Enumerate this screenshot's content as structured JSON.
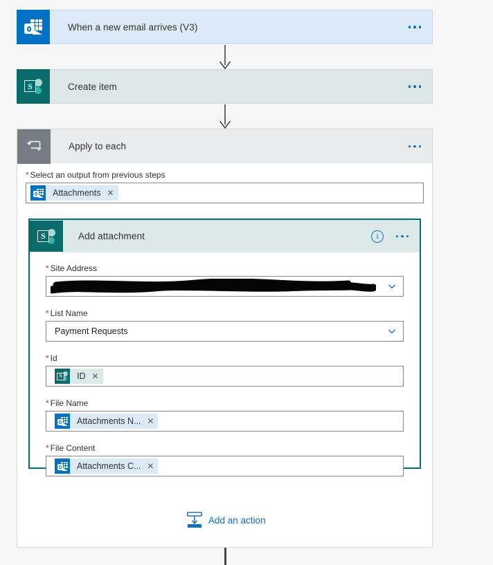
{
  "page": {
    "background_color": "#f6f6f6",
    "app": "Power Automate flow designer"
  },
  "flow": {
    "trigger": {
      "title": "When a new email arrives (V3)",
      "icon": "outlook-icon",
      "header_color": "#dceaf7",
      "menu_label": "..."
    },
    "create_item": {
      "title": "Create item",
      "icon": "sharepoint-icon",
      "header_color": "#dde7e7",
      "menu_label": "..."
    },
    "apply_to_each": {
      "title": "Apply to each",
      "icon": "loop-icon",
      "header_color": "#eaebed",
      "menu_label": "...",
      "select_output": {
        "label": "Select an output from previous steps",
        "required_marker": "*",
        "token": {
          "text": "Attachments",
          "icon": "outlook-icon",
          "remove_label": "✕"
        }
      }
    },
    "add_attachment": {
      "title": "Add attachment",
      "icon": "sharepoint-icon",
      "header_color": "#dde9e9",
      "border_color": "#036c70",
      "info_label": "i",
      "menu_label": "...",
      "fields": [
        {
          "label": "Site Address",
          "required_marker": "*",
          "type": "combo",
          "value": "",
          "redacted": true,
          "chevron": "chevron-down-icon"
        },
        {
          "label": "List Name",
          "required_marker": "*",
          "type": "combo",
          "value": "Payment Requests",
          "redacted": false,
          "chevron": "chevron-down-icon"
        },
        {
          "label": "Id",
          "required_marker": "*",
          "type": "token",
          "token": {
            "text": "ID",
            "icon": "sharepoint-icon",
            "remove_label": "✕"
          }
        },
        {
          "label": "File Name",
          "required_marker": "*",
          "type": "token",
          "token": {
            "text": "Attachments N...",
            "icon": "outlook-icon",
            "remove_label": "✕"
          }
        },
        {
          "label": "File Content",
          "required_marker": "*",
          "type": "token",
          "token": {
            "text": "Attachments C...",
            "icon": "outlook-icon",
            "remove_label": "✕"
          }
        }
      ]
    },
    "add_action": {
      "label": "Add an action",
      "icon": "insert-action-icon",
      "color": "#0b6cbf"
    }
  },
  "icons": {
    "sharepoint_letter": "S"
  },
  "colors": {
    "outlook_blue": "#0072c6",
    "sharepoint_teal": "#0b6a6a",
    "loop_gray": "#767b84",
    "link_blue": "#0b6cbf",
    "required_red": "#d13438",
    "connector_gray": "#484644"
  }
}
